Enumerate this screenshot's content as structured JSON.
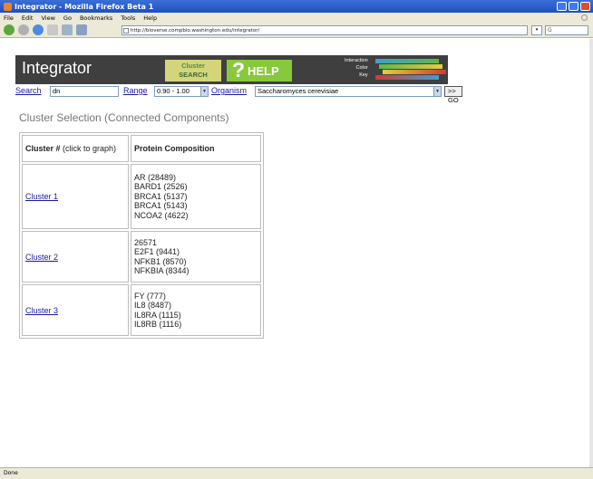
{
  "window": {
    "title": "Integrator - Mozilla Firefox Beta 1"
  },
  "menu": [
    "File",
    "Edit",
    "View",
    "Go",
    "Bookmarks",
    "Tools",
    "Help"
  ],
  "browser": {
    "url": "http://bioverse.compbio.washington.edu/integrator/",
    "status": "Done"
  },
  "banner": {
    "logo": "Integrator",
    "cluster_tab_line1": "Cluster",
    "cluster_tab_line2": "SEARCH",
    "help_q": "?",
    "help_label": "HELP",
    "key_line1": "Interaction",
    "key_line2": "Color",
    "key_line3": "Key",
    "key_colors": [
      "#3aa0d8",
      "#5cb84a",
      "#e0d040",
      "#d43a30"
    ]
  },
  "search_row": {
    "search_link": "Search",
    "search_value": "dn",
    "range_link": "Range",
    "range_value": "0.90 - 1.00",
    "organism_link": "Organism",
    "organism_value": "Saccharomyces cerevisiae",
    "go_label": ">> GO"
  },
  "heading": "Cluster Selection (Connected Components)",
  "table": {
    "header_col1_bold": "Cluster #",
    "header_col1_note": " (click to graph)",
    "header_col2": "Protein Composition",
    "rows": [
      {
        "cluster": "Cluster 1",
        "proteins": [
          "AR (28489)",
          "BARD1 (2526)",
          "BRCA1 (5137)",
          "BRCA1 (5143)",
          "NCOA2 (4622)"
        ]
      },
      {
        "cluster": "Cluster 2",
        "proteins": [
          "26571",
          "E2F1 (9441)",
          "NFKB1 (8570)",
          "NFKBIA (8344)"
        ]
      },
      {
        "cluster": "Cluster 3",
        "proteins": [
          "FY (777)",
          "IL8 (8487)",
          "IL8RA (1115)",
          "IL8RB (1116)"
        ]
      }
    ]
  }
}
